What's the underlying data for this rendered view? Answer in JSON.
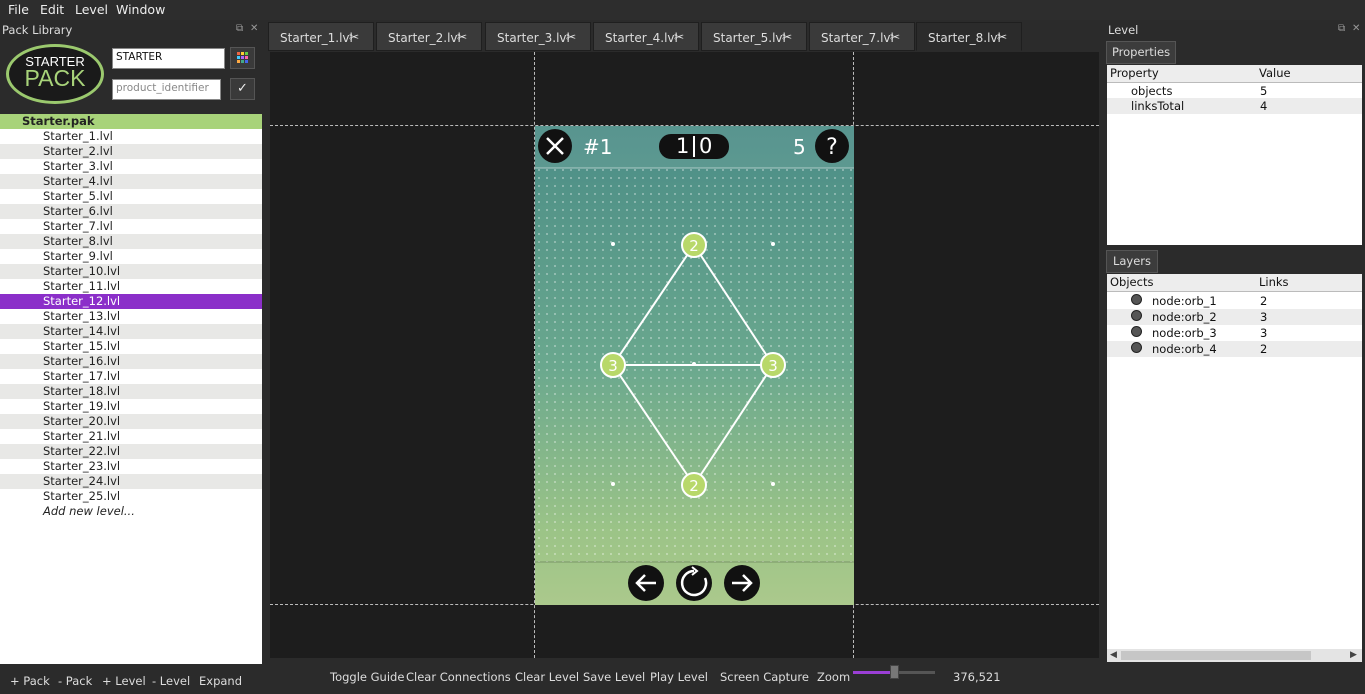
{
  "menu": [
    "File",
    "Edit",
    "Level",
    "Window"
  ],
  "pack_panel": {
    "title": "Pack Library",
    "logo_line1": "STARTER",
    "logo_line2": "PACK",
    "name_value": "STARTER",
    "identifier_placeholder": "product_identifier",
    "pack_file": "Starter.pak",
    "levels": [
      "Starter_1.lvl",
      "Starter_2.lvl",
      "Starter_3.lvl",
      "Starter_4.lvl",
      "Starter_5.lvl",
      "Starter_6.lvl",
      "Starter_7.lvl",
      "Starter_8.lvl",
      "Starter_9.lvl",
      "Starter_10.lvl",
      "Starter_11.lvl",
      "Starter_12.lvl",
      "Starter_13.lvl",
      "Starter_14.lvl",
      "Starter_15.lvl",
      "Starter_16.lvl",
      "Starter_17.lvl",
      "Starter_18.lvl",
      "Starter_19.lvl",
      "Starter_20.lvl",
      "Starter_21.lvl",
      "Starter_22.lvl",
      "Starter_23.lvl",
      "Starter_24.lvl",
      "Starter_25.lvl"
    ],
    "selected_level": "Starter_12.lvl",
    "add_new": "Add new level...",
    "buttons": [
      "+ Pack",
      "- Pack",
      "+ Level",
      "- Level",
      "Expand"
    ]
  },
  "tabs": [
    "Starter_1.lvl",
    "Starter_2.lvl",
    "Starter_3.lvl",
    "Starter_4.lvl",
    "Starter_5.lvl",
    "Starter_7.lvl",
    "Starter_8.lvl"
  ],
  "active_tab": "Starter_8.lvl",
  "game": {
    "level_number": "#1",
    "score_left": "1",
    "score_right": "0",
    "moves": "5",
    "help": "?",
    "nodes": [
      {
        "id": "top",
        "value": "2"
      },
      {
        "id": "left",
        "value": "3"
      },
      {
        "id": "right",
        "value": "3"
      },
      {
        "id": "bottom",
        "value": "2"
      }
    ]
  },
  "toolbar": {
    "buttons": [
      "Toggle Guide",
      "Clear Connections",
      "Clear Level",
      "Save Level",
      "Play Level",
      "Screen Capture"
    ],
    "zoom_label": "Zoom",
    "zoom_level": 0.5,
    "coords": "376,521"
  },
  "level_panel": {
    "title": "Level",
    "properties_tab": "Properties",
    "prop_headers": [
      "Property",
      "Value"
    ],
    "properties": [
      {
        "name": "objects",
        "value": "5"
      },
      {
        "name": "linksTotal",
        "value": "4"
      }
    ],
    "layers_tab": "Layers",
    "layer_headers": [
      "Objects",
      "Links"
    ],
    "layers": [
      {
        "name": "node:orb_1",
        "links": "2"
      },
      {
        "name": "node:orb_2",
        "links": "3"
      },
      {
        "name": "node:orb_3",
        "links": "3"
      },
      {
        "name": "node:orb_4",
        "links": "2"
      }
    ]
  },
  "colors": {
    "selection": "#8b2fc9",
    "pack_header": "#a8d37a",
    "node_fill": "#b8d86a"
  }
}
